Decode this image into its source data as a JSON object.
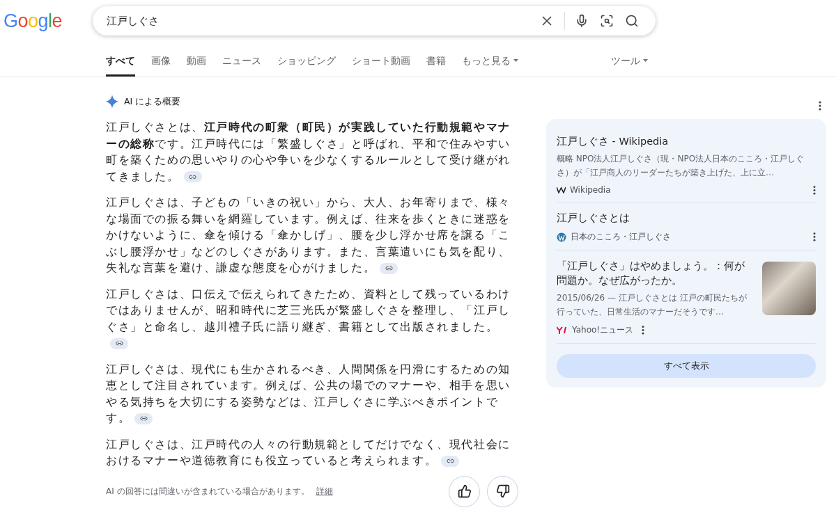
{
  "logo": "Google",
  "search": {
    "value": "江戸しぐさ"
  },
  "tabs": [
    {
      "label": "すべて",
      "selected": true,
      "dropdown": false
    },
    {
      "label": "画像",
      "selected": false,
      "dropdown": false
    },
    {
      "label": "動画",
      "selected": false,
      "dropdown": false
    },
    {
      "label": "ニュース",
      "selected": false,
      "dropdown": false
    },
    {
      "label": "ショッピング",
      "selected": false,
      "dropdown": false
    },
    {
      "label": "ショート動画",
      "selected": false,
      "dropdown": false
    },
    {
      "label": "書籍",
      "selected": false,
      "dropdown": false
    },
    {
      "label": "もっと見る",
      "selected": false,
      "dropdown": true
    }
  ],
  "tools": "ツール",
  "overview": {
    "title": "AI による概要",
    "paragraphs": [
      "江戸しぐさとは、**江戸時代の町衆（町民）が実践していた行動規範やマナーの総称**です。江戸時代には「繁盛しぐさ」と呼ばれ、平和で住みやすい町を築くための思いやりの心や争いを少なくするルールとして受け継がれてきました。",
      "江戸しぐさは、子どもの「いきの祝い」から、大人、お年寄りまで、様々な場面での振る舞いを網羅しています。例えば、往来を歩くときに迷惑をかけないように、傘を傾ける「傘かしげ」、腰を少し浮かせ席を譲る「こぶし腰浮かせ」などのしぐさがあります。また、言葉遣いにも気を配り、失礼な言葉を避け、謙虚な態度を心がけました。",
      "江戸しぐさは、口伝えで伝えられてきたため、資料として残っているわけではありませんが、昭和時代に芝三光氏が繁盛しぐさを整理し、「江戸しぐさ」と命名し、越川禮子氏に語り継ぎ、書籍として出版されました。",
      "江戸しぐさは、現代にも生かされるべき、人間関係を円滑にするための知恵として注目されています。例えば、公共の場でのマナーや、相手を思いやる気持ちを大切にする姿勢などは、江戸しぐさに学ぶべきポイントです。",
      "江戸しぐさは、江戸時代の人々の行動規範としてだけでなく、現代社会におけるマナーや道徳教育にも役立っていると考えられます。"
    ],
    "disclaimer": "AI の回答には間違いが含まれている場合があります。",
    "details_link": "詳細"
  },
  "sources": [
    {
      "kind": "wiki",
      "title": "江戸しぐさ - Wikipedia",
      "snippet": "概略 NPO法人江戸しぐさ（現・NPO法人日本のこころ・江戸しぐさ）が「江戸商人のリーダーたちが築き上げた、上に立…",
      "site": "Wikipedia",
      "thumbnail": false
    },
    {
      "kind": "wordpress",
      "title": "江戸しぐさとは",
      "site": "日本のこころ・江戸しぐさ",
      "thumbnail": false
    },
    {
      "kind": "yahoo",
      "title": "「江戸しぐさ」はやめましょう。：何が問題か。なぜ広がったか。",
      "snippet": "2015/06/26 — 江戸しぐさとは 江戸の町民たちが行っていた、日常生活のマナーだそうです…",
      "site": "Yahoo!ニュース",
      "thumbnail": true
    }
  ],
  "show_all": "すべて表示"
}
